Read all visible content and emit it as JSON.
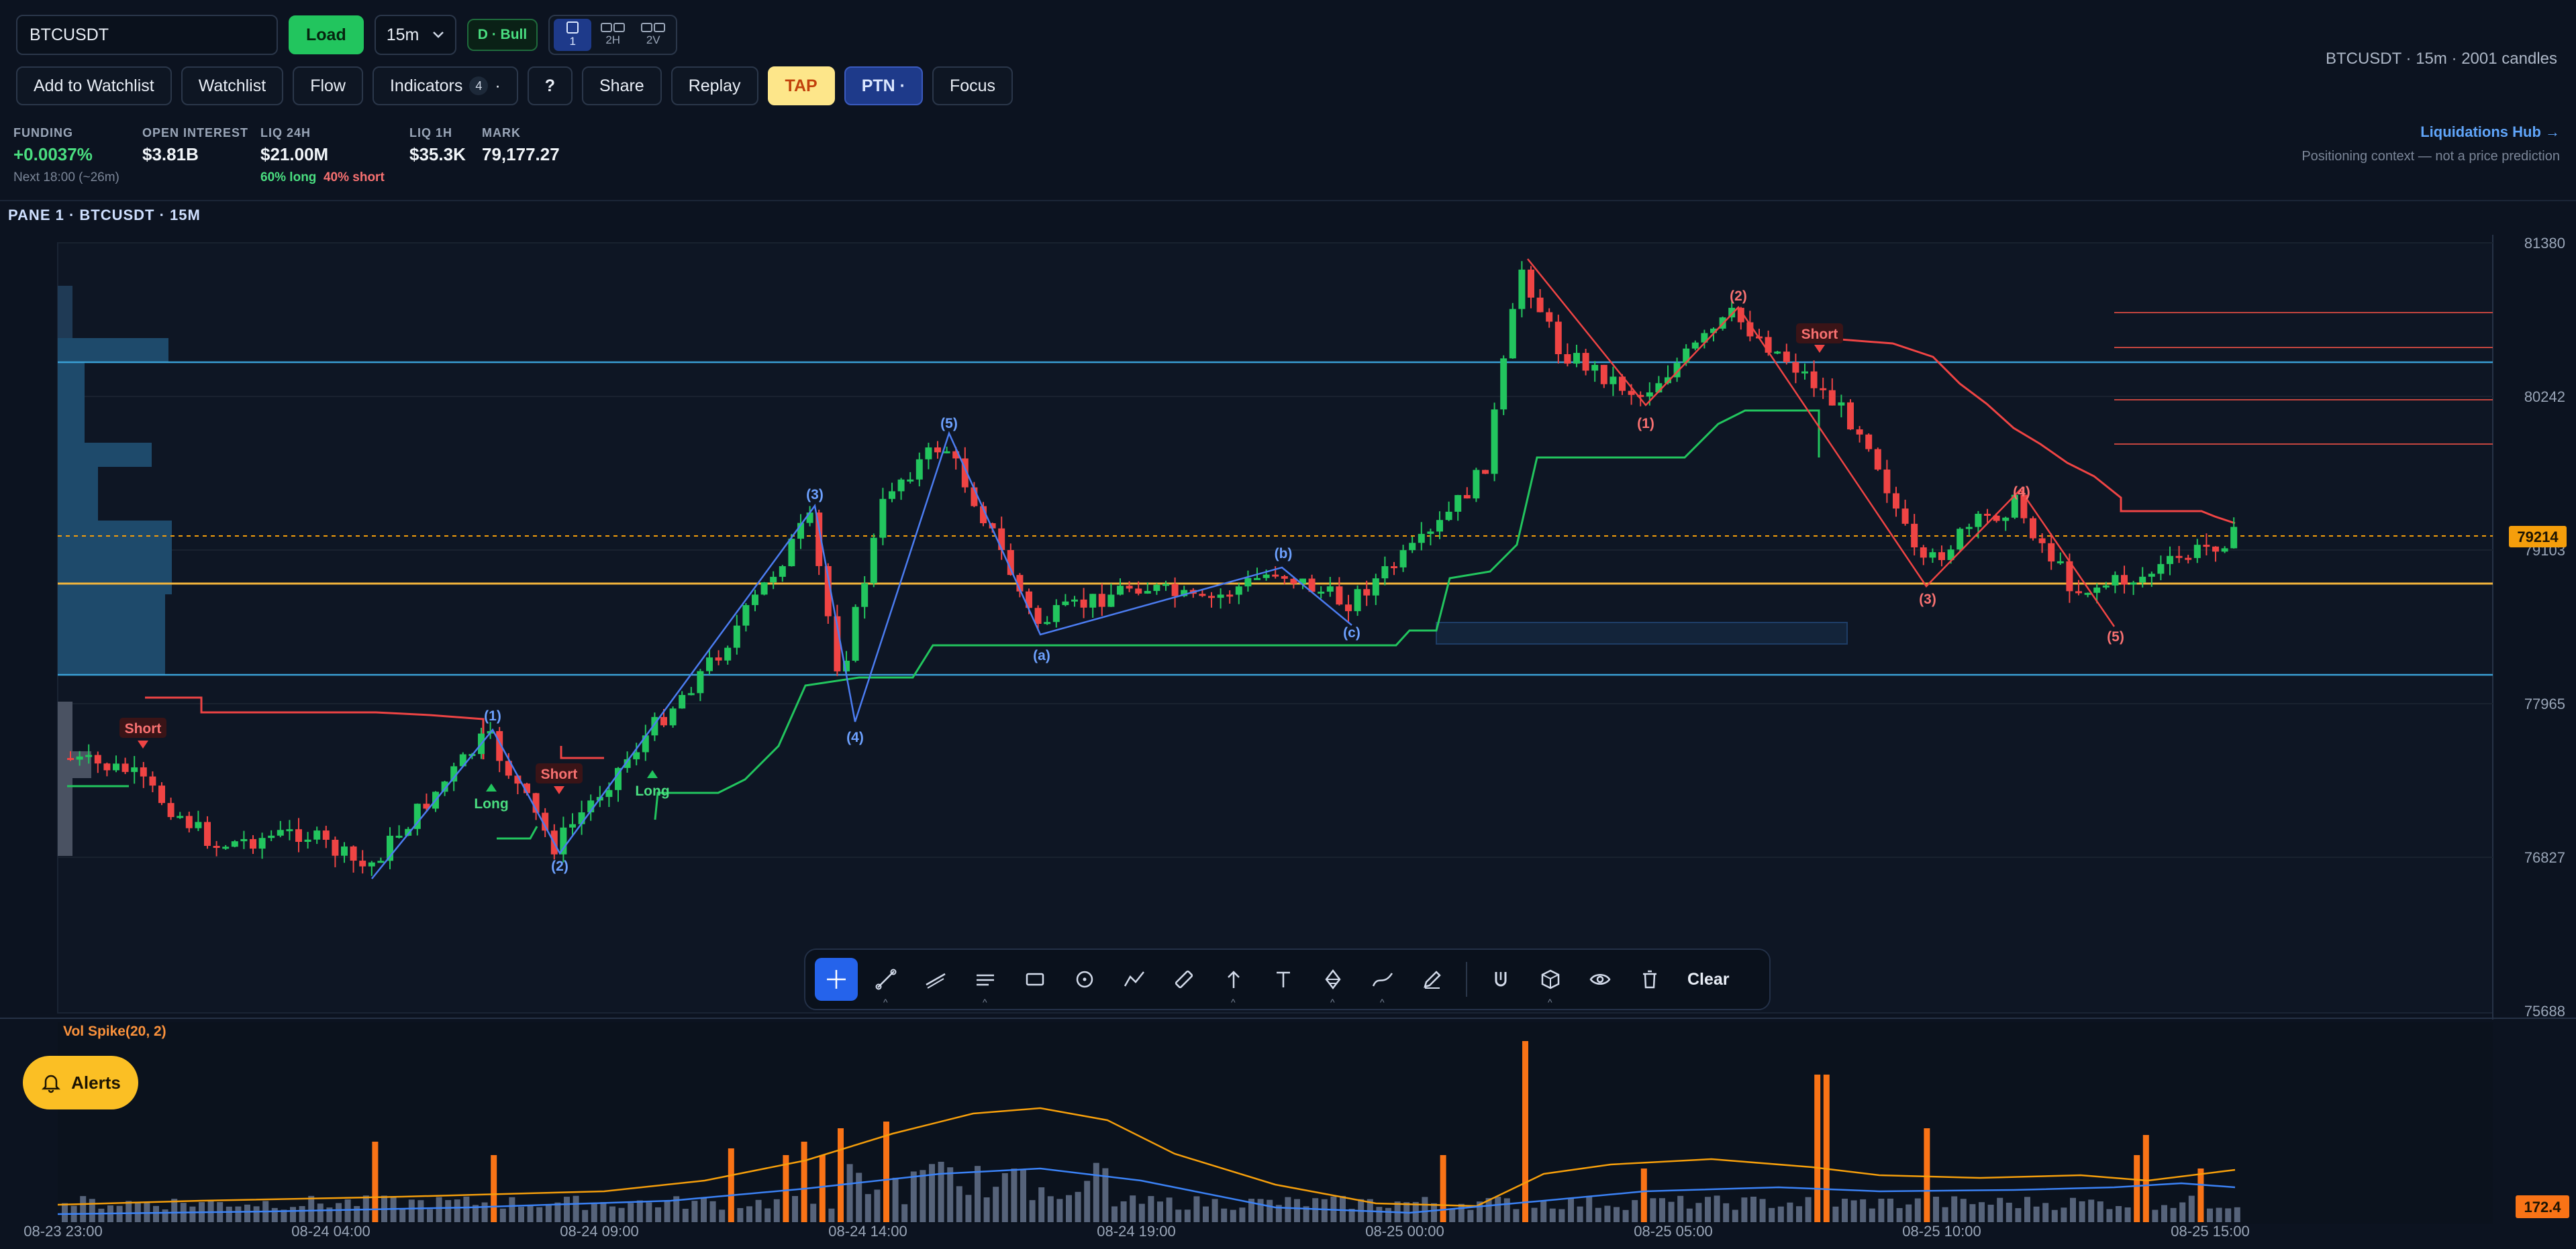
{
  "toolbar": {
    "symbol_value": "BTCUSDT",
    "load_label": "Load",
    "timeframe": "15m",
    "bias_label": "D · Bull",
    "layouts": [
      "1",
      "2H",
      "2V"
    ],
    "row2": {
      "watchlist_add": "Add to Watchlist",
      "watchlist": "Watchlist",
      "flow": "Flow",
      "indicators": "Indicators",
      "indicators_count": "4",
      "indicators_caret": "·",
      "help": "?",
      "share": "Share",
      "replay": "Replay",
      "tap": "TAP",
      "ptn": "PTN ·",
      "focus": "Focus"
    },
    "meta": "BTCUSDT · 15m · 2001 candles"
  },
  "stats": {
    "funding": {
      "label": "FUNDING",
      "value": "+0.0037%",
      "sub": "Next 18:00 (~26m)"
    },
    "open_interest": {
      "label": "OPEN INTEREST",
      "value": "$3.81B"
    },
    "liq24": {
      "label": "LIQ 24H",
      "value": "$21.00M",
      "long": "60% long",
      "short": "40% short"
    },
    "liq1": {
      "label": "LIQ 1H",
      "value": "$35.3K"
    },
    "mark": {
      "label": "MARK",
      "value": "79,177.27"
    },
    "hub_link": "Liquidations Hub →",
    "hub_note": "Positioning context — not a price prediction"
  },
  "pane": {
    "title": "PANE 1 · BTCUSDT · 15M",
    "price_axis": [
      "81380",
      "80242",
      "79103",
      "77965",
      "76827",
      "75688"
    ],
    "last_price": "79214",
    "time_axis": [
      "08-23 23:00",
      "08-24 04:00",
      "08-24 09:00",
      "08-24 14:00",
      "08-24 19:00",
      "08-25 00:00",
      "08-25 05:00",
      "08-25 10:00",
      "08-25 15:00"
    ],
    "signals": [
      {
        "text": "Short",
        "kind": "short"
      },
      {
        "text": "Long",
        "kind": "long"
      },
      {
        "text": "Short",
        "kind": "short"
      },
      {
        "text": "Long",
        "kind": "long"
      },
      {
        "text": "Short",
        "kind": "short"
      }
    ],
    "blue_waves": [
      "(1)",
      "(2)",
      "(3)",
      "(4)",
      "(5)",
      "(a)",
      "(b)",
      "(c)"
    ],
    "red_waves": [
      "(1)",
      "(2)",
      "(3)",
      "(4)",
      "(5)"
    ]
  },
  "drawing_tools": {
    "items": [
      "crosshair",
      "trend-line",
      "ray",
      "horizontal-line",
      "rectangle",
      "circle",
      "polyline",
      "ruler",
      "arrow",
      "text",
      "fib",
      "path",
      "brush",
      "magnet",
      "cube",
      "eye",
      "trash"
    ],
    "clear_label": "Clear"
  },
  "volume": {
    "title": "Vol Spike(20, 2)",
    "last_value": "172.4"
  },
  "alerts_label": "Alerts",
  "colors": {
    "bg": "#0c1320",
    "up": "#22c55e",
    "down": "#ef4444",
    "accent_blue": "#3b82f6",
    "accent_orange": "#f59e0b"
  }
}
